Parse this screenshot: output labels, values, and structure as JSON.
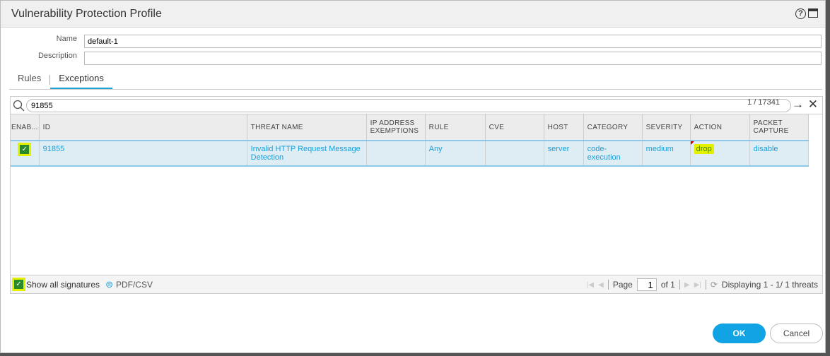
{
  "dialog": {
    "title": "Vulnerability Protection Profile",
    "help_icon": "?"
  },
  "form": {
    "name_label": "Name",
    "name_value": "default-1",
    "description_label": "Description",
    "description_value": ""
  },
  "tabs": [
    {
      "label": "Rules",
      "active": false
    },
    {
      "label": "Exceptions",
      "active": true
    }
  ],
  "search": {
    "value": "91855",
    "count": "1 / 17341"
  },
  "table": {
    "headers": [
      "ENAB...",
      "ID",
      "THREAT NAME",
      "IP ADDRESS EXEMPTIONS",
      "RULE",
      "CVE",
      "HOST",
      "CATEGORY",
      "SEVERITY",
      "ACTION",
      "PACKET CAPTURE"
    ],
    "rows": [
      {
        "enabled": true,
        "id": "91855",
        "threat_name": "Invalid HTTP Request Message Detection",
        "ip_exemptions": "",
        "rule": "Any",
        "cve": "",
        "host": "server",
        "category": "code-execution",
        "severity": "medium",
        "action": "drop",
        "packet_capture": "disable"
      }
    ]
  },
  "footer": {
    "show_all_label": "Show all signatures",
    "show_all_checked": true,
    "pdf_label": "PDF/CSV",
    "page_label": "Page",
    "page_value": "1",
    "of_label": "of 1",
    "displaying": "Displaying 1 - 1/ 1 threats"
  },
  "buttons": {
    "ok": "OK",
    "cancel": "Cancel"
  },
  "colors": {
    "accent": "#12a3e5",
    "highlight": "#e5f000",
    "link": "#1a9fd9"
  }
}
